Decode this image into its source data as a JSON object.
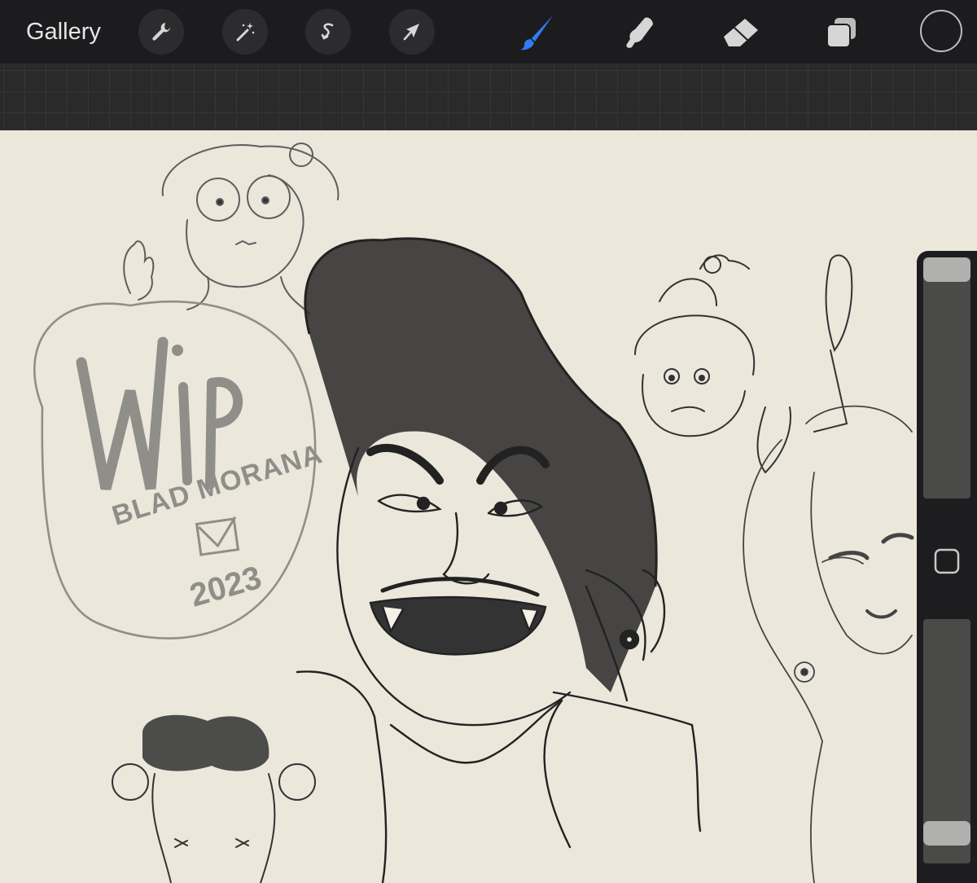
{
  "toolbar": {
    "gallery_label": "Gallery",
    "left_tools": [
      "wrench-icon",
      "magic-wand-icon",
      "selection-icon",
      "transform-arrow-icon"
    ],
    "right_tools": [
      "brush-icon",
      "smudge-icon",
      "eraser-icon",
      "layers-icon"
    ],
    "active_tool": "brush-icon",
    "active_color": "#2f7cf6",
    "current_color": "#1c1c1e"
  },
  "canvas": {
    "watermark": {
      "text": "WIP",
      "artist": "BLAD MORANA",
      "year": "2023"
    },
    "paper_color": "#ebe7db"
  },
  "sidebar": {
    "brush_size_level": 0.0,
    "opacity_level": 0.92,
    "modify_icon": "square-icon"
  }
}
